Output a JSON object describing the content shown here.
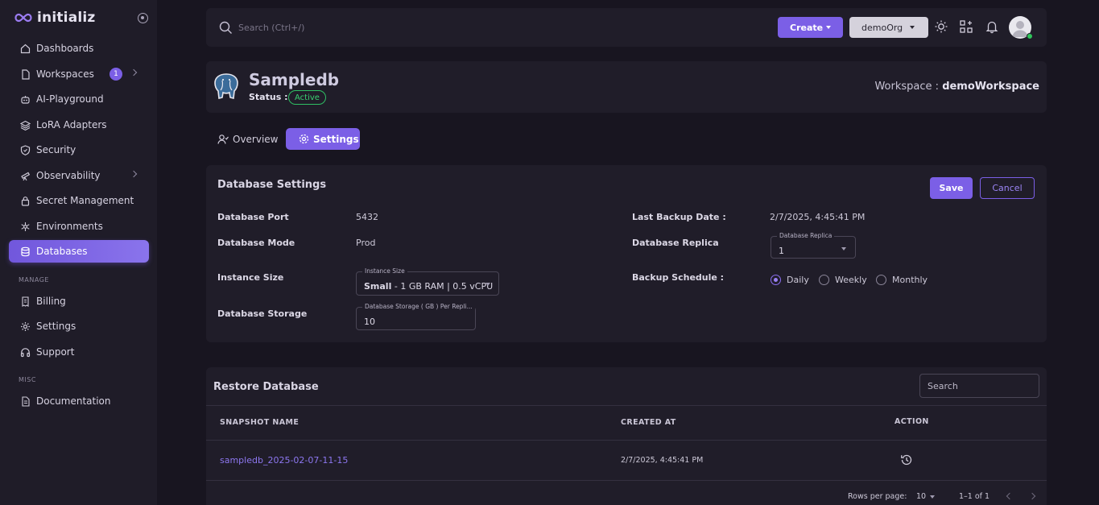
{
  "app": {
    "name": "initializ"
  },
  "sidebar": {
    "items": [
      {
        "label": "Dashboards",
        "icon": "home-icon"
      },
      {
        "label": "Workspaces",
        "icon": "file-icon",
        "badge": "1"
      },
      {
        "label": "AI-Playground",
        "icon": "robot-icon"
      },
      {
        "label": "LoRA Adapters",
        "icon": "layers-icon"
      },
      {
        "label": "Security",
        "icon": "shield-icon"
      },
      {
        "label": "Observability",
        "icon": "telescope-icon"
      },
      {
        "label": "Secret Management",
        "icon": "lock-icon"
      },
      {
        "label": "Environments",
        "icon": "snowflake-icon"
      },
      {
        "label": "Databases",
        "icon": "database-icon"
      }
    ],
    "manage_title": "MANAGE",
    "manage_items": [
      {
        "label": "Billing",
        "icon": "receipt-icon"
      },
      {
        "label": "Settings",
        "icon": "gear-icon"
      },
      {
        "label": "Support",
        "icon": "headphones-icon"
      }
    ],
    "misc_title": "MISC",
    "misc_items": [
      {
        "label": "Documentation",
        "icon": "document-icon"
      }
    ]
  },
  "topbar": {
    "search_placeholder": "Search (Ctrl+/)",
    "create_label": "Create",
    "org_label": "demoOrg"
  },
  "header": {
    "db_name": "Sampledb",
    "status_label": "Status :",
    "status_value": "Active",
    "workspace_label": "Workspace :",
    "workspace_value": "demoWorkspace"
  },
  "tabs": {
    "overview": "Overview",
    "settings": "Settings"
  },
  "settings": {
    "title": "Database Settings",
    "save_label": "Save",
    "cancel_label": "Cancel",
    "port_label": "Database Port",
    "port_value": "5432",
    "mode_label": "Database Mode",
    "mode_value": "Prod",
    "instance_label": "Instance Size",
    "instance_legend": "Instance Size",
    "instance_value_bold": "Small",
    "instance_value_rest": " - 1 GB RAM | 0.5 vCPU",
    "storage_label": "Database Storage",
    "storage_legend": "Database Storage ( GB ) Per Repli...",
    "storage_value": "10",
    "backup_date_label": "Last Backup Date :",
    "backup_date_value": "2/7/2025, 4:45:41 PM",
    "replica_label": "Database Replica",
    "replica_legend": "Database Replica",
    "replica_value": "1",
    "schedule_label": "Backup Schedule :",
    "schedule_options": [
      "Daily",
      "Weekly",
      "Monthly"
    ],
    "schedule_selected": "Daily"
  },
  "restore": {
    "title": "Restore Database",
    "search_placeholder": "Search",
    "columns": [
      "SNAPSHOT NAME",
      "CREATED AT",
      "ACTION"
    ],
    "rows": [
      {
        "snapshot": "sampledb_2025-02-07-11-15",
        "created_at": "2/7/2025, 4:45:41 PM"
      }
    ],
    "rows_per_page_label": "Rows per page:",
    "rows_per_page_value": "10",
    "range": "1–1 of 1"
  },
  "colors": {
    "accent": "#7b5fe6",
    "active_status": "#39d070"
  }
}
